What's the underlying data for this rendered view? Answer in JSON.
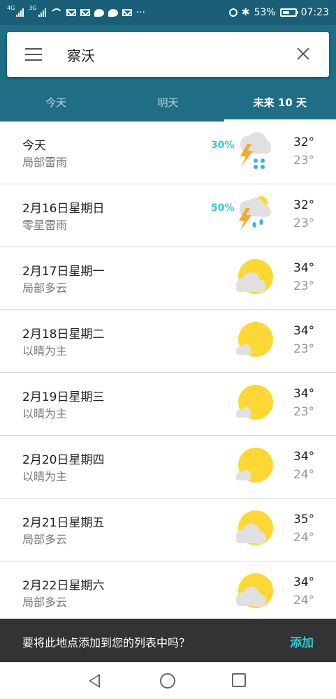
{
  "status_bar": {
    "signal1": "4G",
    "signal2": "3G",
    "battery": "53%",
    "time": "07:23"
  },
  "search": {
    "query": "察沃"
  },
  "tabs": [
    {
      "label": "今天",
      "active": false
    },
    {
      "label": "明天",
      "active": false
    },
    {
      "label": "未来 10 天",
      "active": true
    }
  ],
  "forecast": [
    {
      "day": "今天",
      "condition": "局部雷雨",
      "precip": "30%",
      "high": "32°",
      "low": "23°",
      "icon": "thunderstorm-icon"
    },
    {
      "day": "2月16日星期日",
      "condition": "零星雷雨",
      "precip": "50%",
      "high": "32°",
      "low": "23°",
      "icon": "scattered-thunderstorm-icon"
    },
    {
      "day": "2月17日星期一",
      "condition": "局部多云",
      "precip": "",
      "high": "34°",
      "low": "23°",
      "icon": "partly-cloudy-icon"
    },
    {
      "day": "2月18日星期二",
      "condition": "以晴为主",
      "precip": "",
      "high": "34°",
      "low": "23°",
      "icon": "mostly-sunny-icon"
    },
    {
      "day": "2月19日星期三",
      "condition": "以晴为主",
      "precip": "",
      "high": "34°",
      "low": "23°",
      "icon": "mostly-sunny-icon"
    },
    {
      "day": "2月20日星期四",
      "condition": "以晴为主",
      "precip": "",
      "high": "34°",
      "low": "24°",
      "icon": "mostly-sunny-icon"
    },
    {
      "day": "2月21日星期五",
      "condition": "局部多云",
      "precip": "",
      "high": "35°",
      "low": "24°",
      "icon": "partly-cloudy-icon"
    },
    {
      "day": "2月22日星期六",
      "condition": "局部多云",
      "precip": "",
      "high": "34°",
      "low": "24°",
      "icon": "partly-cloudy-icon"
    }
  ],
  "snackbar": {
    "message": "要将此地点添加到您的列表中吗？",
    "action": "添加"
  },
  "colors": {
    "header": "#1f6e86",
    "status_bar": "#1a5f77",
    "accent": "#2ecbd8",
    "sun": "#fdd835",
    "cloud": "#e0e0e0",
    "lightning": "#f9a825",
    "rain": "#29b6f6"
  }
}
